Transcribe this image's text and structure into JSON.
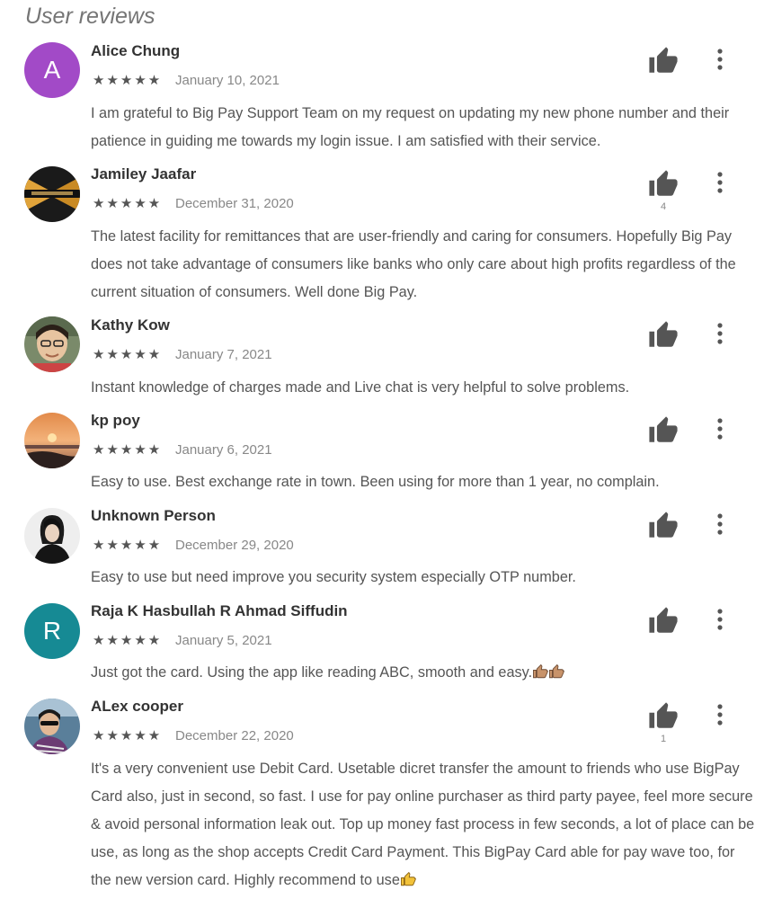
{
  "section": {
    "title": "User reviews"
  },
  "icons": {
    "helpful": "thumbs-up-icon",
    "menu": "more-vert-icon",
    "star": "★",
    "emoji_thumb": "thumbs-up-emoji"
  },
  "colors": {
    "avatar_a": "#a24ac7",
    "avatar_r": "#168a94",
    "icon": "#555555",
    "stars": "#555555",
    "date": "#888888"
  },
  "reviews": [
    {
      "author": "Alice Chung",
      "avatar_letter": "A",
      "stars": "★★★★★",
      "rating": 5,
      "date": "January 10, 2021",
      "text": "I am grateful to Big Pay Support Team on my request on updating my new phone number and their patience in guiding me towards my login issue. I am satisfied with their service.",
      "helpful_count": ""
    },
    {
      "author": "Jamiley Jaafar",
      "stars": "★★★★★",
      "rating": 5,
      "date": "December 31, 2020",
      "text": "The latest facility for remittances that are user-friendly and caring for consumers. Hopefully Big Pay does not take advantage of consumers like banks who only care about high profits regardless of the current situation of consumers. Well done Big Pay.",
      "helpful_count": "4"
    },
    {
      "author": "Kathy Kow",
      "stars": "★★★★★",
      "rating": 5,
      "date": "January 7, 2021",
      "text": "Instant knowledge of charges made and Live chat is very helpful to solve problems.",
      "helpful_count": ""
    },
    {
      "author": "kp poy",
      "stars": "★★★★★",
      "rating": 5,
      "date": "January 6, 2021",
      "text": "Easy to use. Best exchange rate in town. Been using for more than 1 year, no complain.",
      "helpful_count": ""
    },
    {
      "author": "Unknown Person",
      "stars": "★★★★★",
      "rating": 5,
      "date": "December 29, 2020",
      "text": "Easy to use but need improve you security system especially OTP number.",
      "helpful_count": ""
    },
    {
      "author": "Raja K Hasbullah R Ahmad Siffudin",
      "avatar_letter": "R",
      "stars": "★★★★★",
      "rating": 5,
      "date": "January 5, 2021",
      "text": "Just got the card. Using the app like reading ABC, smooth and easy.",
      "helpful_count": ""
    },
    {
      "author": "ALex cooper",
      "stars": "★★★★★",
      "rating": 5,
      "date": "December 22, 2020",
      "text": "It's a very convenient use Debit Card. Usetable dicret transfer the amount to friends who use BigPay Card also, just in second, so fast. I use for pay online purchaser as third party payee, feel more secure & avoid personal information leak out. Top up money fast process in few seconds, a lot of place can be use, as long as the shop accepts Credit Card Payment. This BigPay Card able for pay wave too, for the new version card. Highly recommend to use",
      "helpful_count": "1"
    }
  ]
}
